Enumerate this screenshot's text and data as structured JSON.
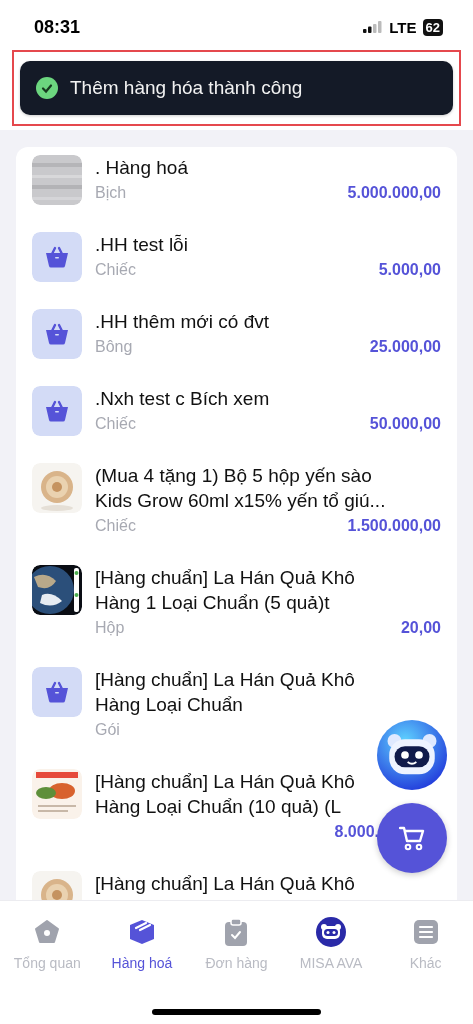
{
  "status_bar": {
    "time": "08:31",
    "network": "LTE",
    "battery": "62"
  },
  "toast": {
    "message": "Thêm hàng hóa thành công",
    "highlighted": true
  },
  "products": [
    {
      "title": ". Hàng hoá",
      "unit": "Bịch",
      "price": "5.000.000,00",
      "kind": "picture"
    },
    {
      "title": ".HH test lỗi",
      "unit": "Chiếc",
      "price": "5.000,00",
      "kind": "basket"
    },
    {
      "title": ".HH thêm mới có đvt",
      "unit": "Bông",
      "price": "25.000,00",
      "kind": "basket"
    },
    {
      "title": ".Nxh test c Bích xem",
      "unit": "Chiếc",
      "price": "50.000,00",
      "kind": "basket"
    },
    {
      "title": "(Mua 4 tặng 1) Bộ 5 hộp yến sào\nKids Grow 60ml x15% yến tổ giú...",
      "unit": "Chiếc",
      "price": "1.500.000,00",
      "kind": "picture"
    },
    {
      "title": "[Hàng chuẩn] La Hán Quả Khô\nHàng 1 Loại Chuẩn (5 quả)t",
      "unit": "Hộp",
      "price": "20,00",
      "kind": "picture"
    },
    {
      "title": "[Hàng chuẩn] La Hán Quả Khô\nHàng Loại Chuẩn",
      "unit": "Gói",
      "kind": "basket"
    },
    {
      "title": "[Hàng chuẩn] La Hán Quả Khô\nHàng Loại Chuẩn (10 quả) (L",
      "price": "8.000.",
      "kind": "picture"
    },
    {
      "title": "[Hàng chuẩn] La Hán Quả Khô",
      "kind": "picture"
    }
  ],
  "tabs": [
    {
      "label": "Tổng quan",
      "selected": false
    },
    {
      "label": "Hàng hoá",
      "selected": true
    },
    {
      "label": "Đơn hàng",
      "selected": false
    },
    {
      "label": "MISA AVA",
      "selected": false
    },
    {
      "label": "Khác",
      "selected": false
    }
  ]
}
